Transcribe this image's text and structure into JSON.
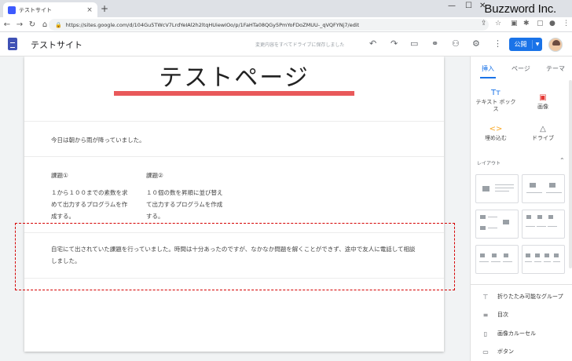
{
  "browser": {
    "tab_title": "テストサイト",
    "tab_close": "×",
    "new_tab": "+",
    "minimize": "—",
    "maximize": "☐",
    "close": "✕",
    "watermark": "Buzzword Inc.",
    "url": "https://sites.google.com/d/104Gu5TWcV7LrdYeIAl2h2ltqHUiewIOo/p/1FaHTa08QGy5PmYoFDoZMUU-_qVQFYNj7/edit"
  },
  "toolbar": {
    "site_name": "テストサイト",
    "save_status": "変更内容をすべてドライブに保存しました",
    "publish_label": "公開"
  },
  "page": {
    "title": "テストページ",
    "intro": "今日は朝から雨が降っていました。",
    "columns": [
      {
        "heading": "課題①",
        "body": "１から１００までの素数を求めて出力するプログラムを作成する。"
      },
      {
        "heading": "課題②",
        "body": "１０個の数を昇順に並び替えて出力するプログラムを作成する。"
      }
    ],
    "highlighted_paragraph": "自宅にて出されていた課題を行っていました。時間は十分あったのですが、なかなか問題を解くことができず、途中で友人に電話して相談しました。"
  },
  "panel": {
    "tabs": [
      "挿入",
      "ページ",
      "テーマ"
    ],
    "insert_items": [
      {
        "icon": "Tт",
        "label": "テキスト ボックス"
      },
      {
        "icon": "▣",
        "label": "画像"
      },
      {
        "icon": "<>",
        "label": "埋め込む"
      },
      {
        "icon": "△",
        "label": "ドライブ"
      }
    ],
    "layouts_label": "レイアウト",
    "components": [
      {
        "icon": "⊤",
        "label": "折りたたみ可能なグループ"
      },
      {
        "icon": "≡",
        "label": "目次"
      },
      {
        "icon": "▯",
        "label": "画像カルーセル"
      },
      {
        "icon": "▭",
        "label": "ボタン"
      }
    ]
  },
  "colors": {
    "accent": "#1a73e8",
    "title_underline": "#e9595a",
    "highlight_border": "#d50000"
  }
}
